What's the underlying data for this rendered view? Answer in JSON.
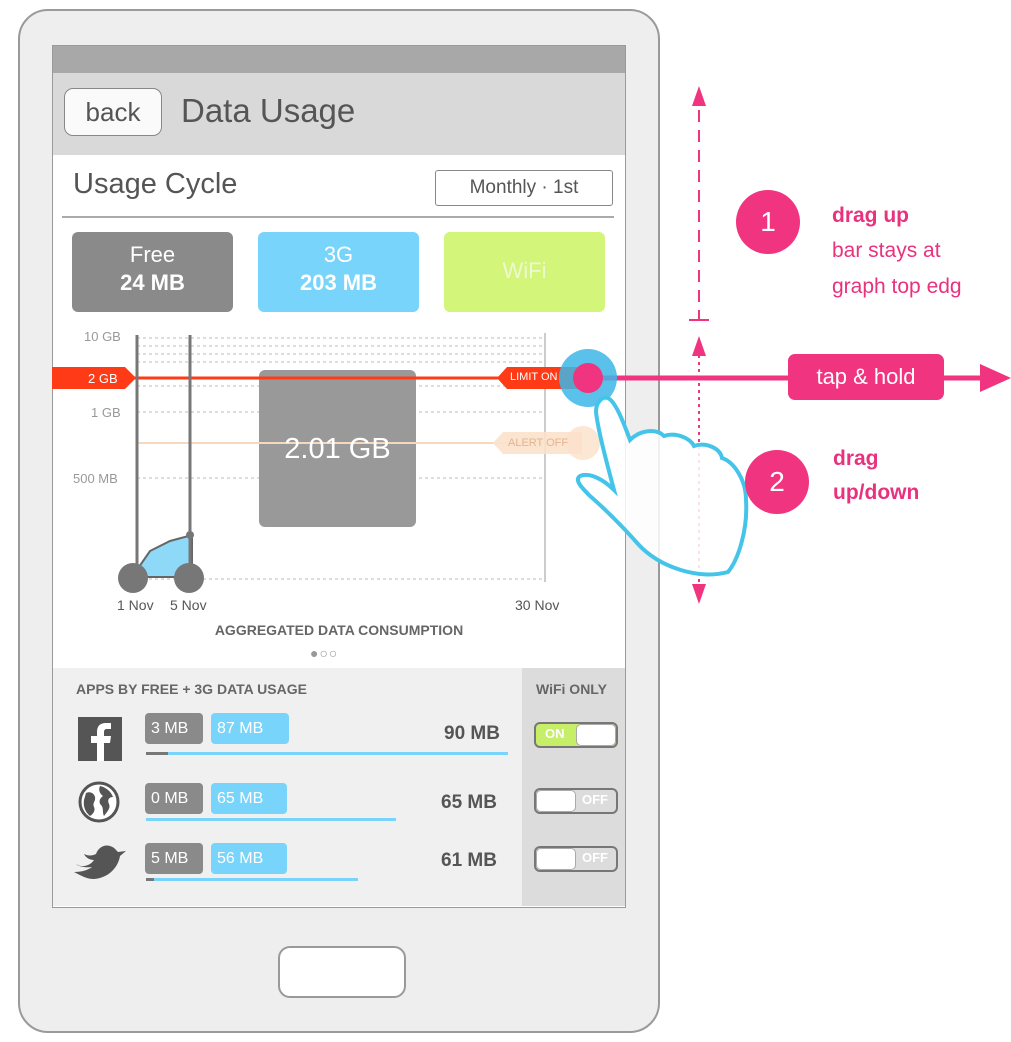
{
  "header": {
    "back_label": "back",
    "title": "Data Usage"
  },
  "cycle": {
    "label": "Usage Cycle",
    "value": "Monthly · 1st"
  },
  "tiles": [
    {
      "label": "Free",
      "value": "24 MB"
    },
    {
      "label": "3G",
      "value": "203 MB"
    },
    {
      "label": "WiFi",
      "value": ""
    }
  ],
  "chart": {
    "y_ticks": [
      "10 GB",
      "2 GB",
      "1 GB",
      "500 MB"
    ],
    "x_ticks": [
      "1 Nov",
      "5 Nov",
      "30 Nov"
    ],
    "limit_label": "LIMIT ON",
    "alert_label": "ALERT OFF",
    "value_box": "2.01 GB",
    "title": "AGGREGATED DATA CONSUMPTION",
    "pager": "●○○"
  },
  "apps": {
    "header": "APPS BY FREE + 3G DATA USAGE",
    "wifi_header": "WiFi ONLY",
    "items": [
      {
        "icon": "facebook-icon",
        "free": "3 MB",
        "g3": "87 MB",
        "total": "90 MB",
        "wifi": "ON"
      },
      {
        "icon": "globe-icon",
        "free": "0 MB",
        "g3": "65 MB",
        "total": "65 MB",
        "wifi": "OFF"
      },
      {
        "icon": "twitter-bird-icon",
        "free": "5 MB",
        "g3": "56 MB",
        "total": "61 MB",
        "wifi": "OFF"
      }
    ]
  },
  "annotations": {
    "step1_num": "1",
    "step1_title": "drag up",
    "step1_line1": "bar stays at",
    "step1_line2": "graph top edg",
    "tap_hold": "tap & hold",
    "step2_num": "2",
    "step2_line1": "drag",
    "step2_line2": "up/down"
  },
  "colors": {
    "free": "#8a8a8a",
    "g3": "#78d4fb",
    "wifi": "#d2f57a",
    "limit": "#ff3a17",
    "accent": "#f0347f"
  }
}
